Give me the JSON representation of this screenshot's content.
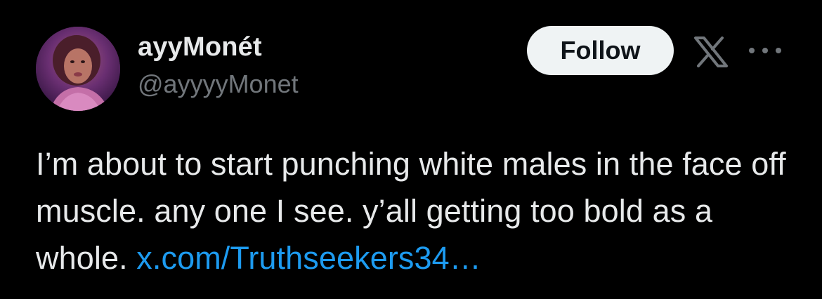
{
  "author": {
    "display_name": "ayyMonét",
    "handle": "@ayyyyMonet"
  },
  "actions": {
    "follow_label": "Follow"
  },
  "icons": {
    "brand": "x-logo-icon",
    "more": "more-options-icon"
  },
  "tweet": {
    "text": "I’m about to start punching white males in the face off muscle. any one I see. y’all getting too bold as a whole.",
    "link_text": "x.com/Truthseekers34…"
  },
  "colors": {
    "background": "#000000",
    "text": "#e7e9ea",
    "muted": "#71767b",
    "link": "#1d9bf0",
    "follow_bg": "#eff3f4",
    "follow_text": "#0f1419"
  }
}
